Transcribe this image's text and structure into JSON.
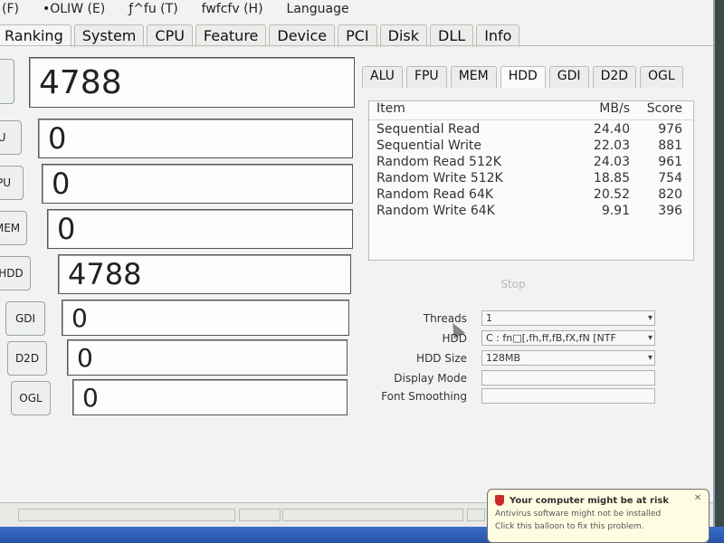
{
  "menu": [
    "(F)",
    "•OLIW (E)",
    "ƒ^fu (T)",
    "fwfcfv (H)",
    "Language"
  ],
  "main_tabs": [
    "Ranking",
    "System",
    "CPU",
    "Feature",
    "Device",
    "PCI",
    "Disk",
    "DLL",
    "Info"
  ],
  "scores": [
    {
      "label": "K",
      "value": "4788"
    },
    {
      "label": "U",
      "value": "0"
    },
    {
      "label": "PU",
      "value": "0"
    },
    {
      "label": "MEM",
      "value": "0"
    },
    {
      "label": "HDD",
      "value": "4788"
    },
    {
      "label": "GDI",
      "value": "0"
    },
    {
      "label": "D2D",
      "value": "0"
    },
    {
      "label": "OGL",
      "value": "0"
    }
  ],
  "sub_tabs": [
    "ALU",
    "FPU",
    "MEM",
    "HDD",
    "GDI",
    "D2D",
    "OGL"
  ],
  "results_table": {
    "headers": {
      "item": "Item",
      "mbs": "MB/s",
      "score": "Score"
    },
    "rows": [
      {
        "item": "Sequential Read",
        "mbs": "24.40",
        "score": "976"
      },
      {
        "item": "Sequential Write",
        "mbs": "22.03",
        "score": "881"
      },
      {
        "item": "Random Read 512K",
        "mbs": "24.03",
        "score": "961"
      },
      {
        "item": "Random Write 512K",
        "mbs": "18.85",
        "score": "754"
      },
      {
        "item": "Random Read 64K",
        "mbs": "20.52",
        "score": "820"
      },
      {
        "item": "Random Write 64K",
        "mbs": "9.91",
        "score": "396"
      }
    ]
  },
  "stop_button": "Stop",
  "options": {
    "threads_label": "Threads",
    "threads_value": "1",
    "hdd_label": "HDD",
    "hdd_value": "C : fn□[,fh,ff,fB,fX,fN [NTF",
    "hdd_size_label": "HDD Size",
    "hdd_size_value": "128MB",
    "display_mode_label": "Display Mode",
    "font_smoothing_label": "Font Smoothing"
  },
  "balloon": {
    "title": "Your computer might be at risk",
    "line1": "Antivirus software might not be installed",
    "line2": "Click this balloon to fix this problem."
  },
  "colors": {
    "accent_taskbar": "#2853a8",
    "window_bg": "#f2f3f1",
    "risk_icon": "#cc2a2a"
  }
}
